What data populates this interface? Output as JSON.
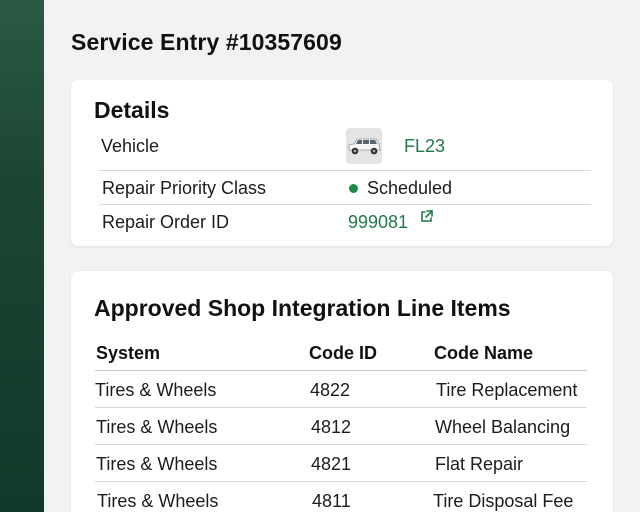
{
  "page": {
    "title": "Service Entry #10357609"
  },
  "details": {
    "heading": "Details",
    "vehicle_label": "Vehicle",
    "vehicle_value": "FL23",
    "priority_label": "Repair Priority Class",
    "priority_value": "Scheduled",
    "repair_order_label": "Repair Order ID",
    "repair_order_value": "999081",
    "colors": {
      "link": "#1f7a4a",
      "status_dot": "#1e8a4c"
    }
  },
  "line_items": {
    "heading": "Approved Shop Integration Line Items",
    "columns": [
      "System",
      "Code ID",
      "Code Name"
    ],
    "rows": [
      [
        "Tires & Wheels",
        "4822",
        "Tire Replacement"
      ],
      [
        "Tires & Wheels",
        "4812",
        "Wheel Balancing"
      ],
      [
        "Tires & Wheels",
        "4821",
        "Flat Repair"
      ],
      [
        "Tires & Wheels",
        "4811",
        "Tire Disposal Fee"
      ]
    ]
  },
  "icons": {
    "vehicle_thumb": "suv-photo-icon",
    "external_link": "external-link-icon"
  },
  "theme": {
    "sidebar": "#1c4634",
    "background": "#f2f2f4"
  }
}
